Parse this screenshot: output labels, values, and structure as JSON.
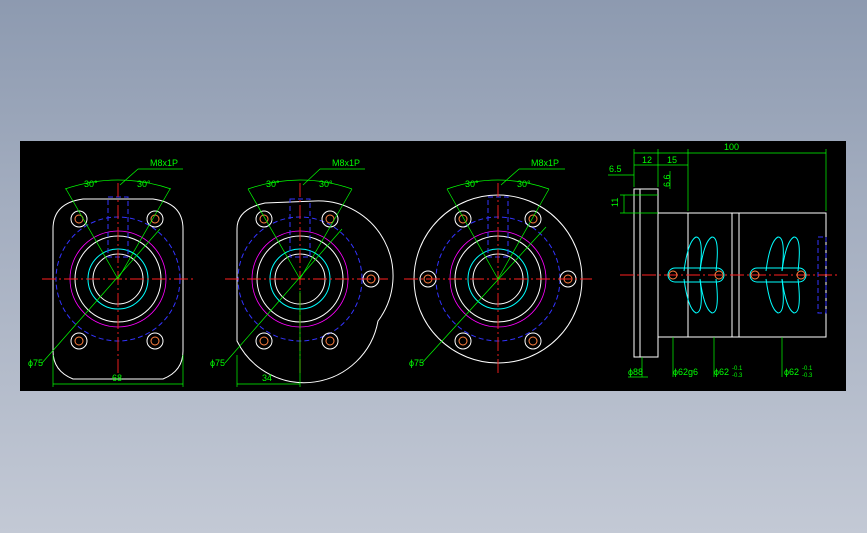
{
  "views": [
    {
      "thread_callout": "M8x1P",
      "angle_left": "30°",
      "angle_right": "30°",
      "dia_label": "ϕ75",
      "width_label": "68"
    },
    {
      "thread_callout": "M8x1P",
      "angle_left": "30°",
      "angle_right": "30°",
      "dia_label": "ϕ75",
      "width_label": "34"
    },
    {
      "thread_callout": "M8x1P",
      "angle_left": "30°",
      "angle_right": "30°",
      "dia_label": "ϕ75"
    }
  ],
  "side_view": {
    "dim_total": "100",
    "dim_12": "12",
    "dim_15": "15",
    "dim_6_5": "6.5",
    "dim_6_6": "6.6",
    "dim_11": "11",
    "dia_flange": "ϕ88",
    "dia_pilot": "ϕ62g6",
    "dia_body_a": "ϕ62",
    "dia_body_b": "ϕ62",
    "tol_upper": "-0.1",
    "tol_lower": "-0.3"
  },
  "colors": {
    "background": "#000000",
    "outline": "#ffffff",
    "inner": "#00ffff",
    "hidden": "#3333ff",
    "centerline": "#ff2020",
    "dimension": "#00ff00",
    "pcd": "#ff00ff"
  }
}
